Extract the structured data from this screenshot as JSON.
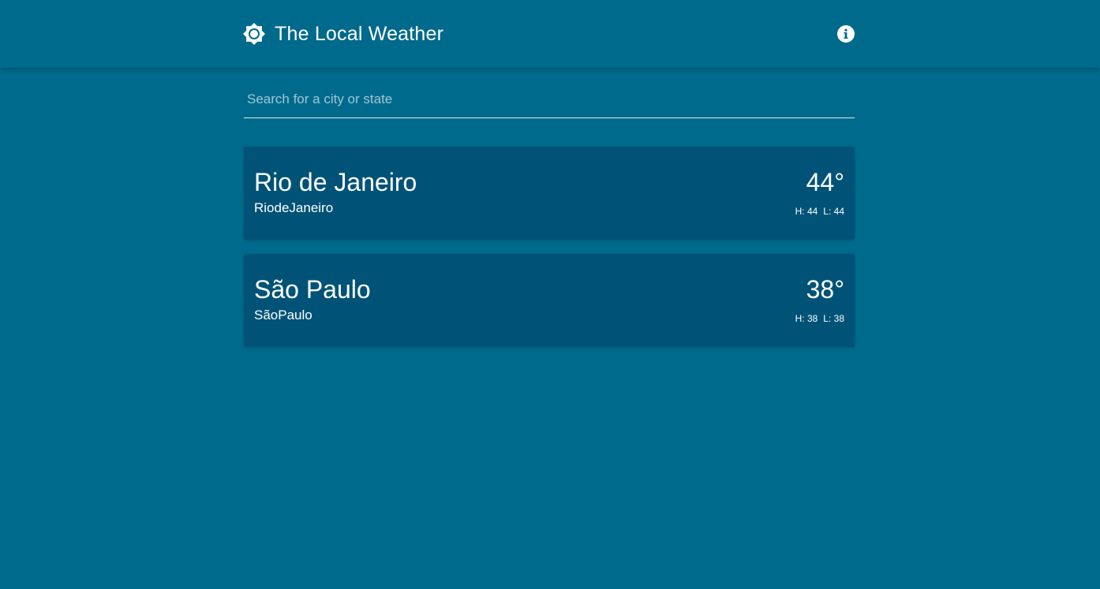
{
  "header": {
    "title": "The Local Weather",
    "brand_icon": "sun-icon",
    "info_icon": "info-icon"
  },
  "search": {
    "placeholder": "Search for a city or state",
    "value": ""
  },
  "cities": [
    {
      "name": "Rio de Janeiro",
      "subtitle": "RiodeJaneiro",
      "temp": "44°",
      "high": "H: 44",
      "low": "L: 44"
    },
    {
      "name": "São Paulo",
      "subtitle": "SãoPaulo",
      "temp": "38°",
      "high": "H: 38",
      "low": "L: 38"
    }
  ],
  "colors": {
    "background": "#006a8c",
    "card": "#005377",
    "text": "#ffffff"
  }
}
